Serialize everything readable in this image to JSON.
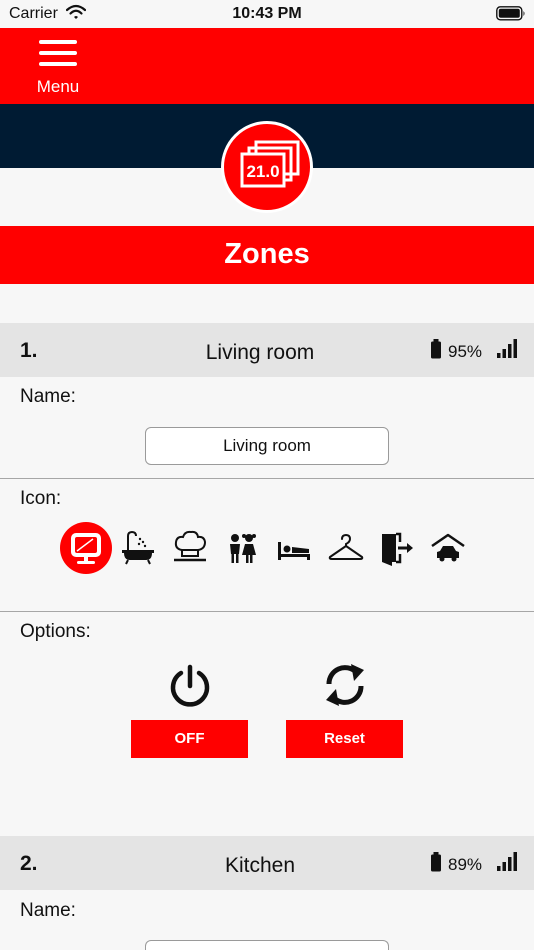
{
  "status_bar": {
    "carrier": "Carrier",
    "time": "10:43 PM"
  },
  "menu": {
    "label": "Menu"
  },
  "logo": {
    "text": "21.0"
  },
  "page": {
    "title": "Zones"
  },
  "zones": [
    {
      "number": "1.",
      "name": "Living room",
      "battery": "95%",
      "name_label": "Name:",
      "name_value": "Living room",
      "icon_label": "Icon:",
      "icons": [
        "monitor-icon",
        "bathtub-icon",
        "chef-hat-icon",
        "children-icon",
        "bed-icon",
        "hanger-icon",
        "door-exit-icon",
        "car-garage-icon"
      ],
      "selected_icon": "monitor-icon",
      "options_label": "Options:",
      "off_label": "OFF",
      "reset_label": "Reset"
    },
    {
      "number": "2.",
      "name": "Kitchen",
      "battery": "89%",
      "name_label": "Name:"
    }
  ],
  "colors": {
    "accent": "#ff0000",
    "navy": "#001b33",
    "background": "#f7f7f7",
    "header_gray": "#e4e4e4"
  }
}
